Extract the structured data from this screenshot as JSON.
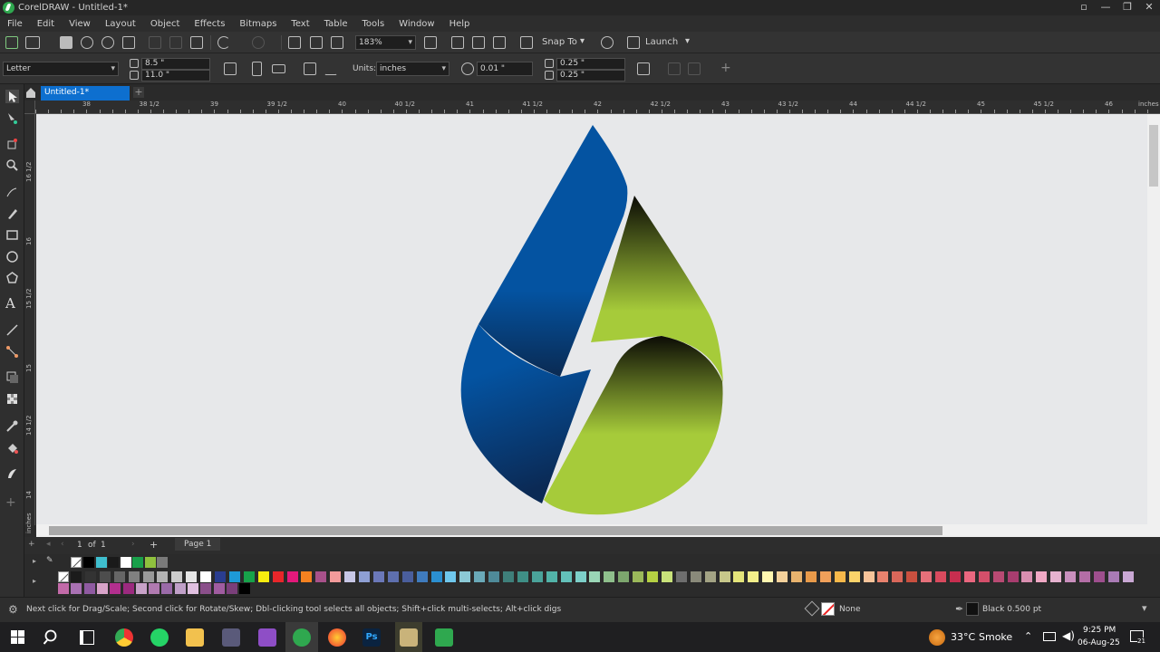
{
  "app": {
    "title": "CorelDRAW - Untitled-1*"
  },
  "menu": [
    "File",
    "Edit",
    "View",
    "Layout",
    "Object",
    "Effects",
    "Bitmaps",
    "Text",
    "Table",
    "Tools",
    "Window",
    "Help"
  ],
  "toolbar": {
    "zoom": "183%",
    "snap_to": "Snap To",
    "launch": "Launch"
  },
  "property_bar": {
    "page_size": "Letter",
    "width": "8.5 \"",
    "height": "11.0 \"",
    "units_label": "Units:",
    "units": "inches",
    "nudge": "0.01 \"",
    "dup_x": "0.25 \"",
    "dup_y": "0.25 \""
  },
  "document_tab": "Untitled-1*",
  "ruler": {
    "h_labels": [
      "38",
      "38 1/2",
      "39",
      "39 1/2",
      "40",
      "40 1/2",
      "41",
      "41 1/2",
      "42",
      "42 1/2",
      "43",
      "43 1/2",
      "44",
      "44 1/2",
      "45",
      "45 1/2",
      "46"
    ],
    "unit": "inches",
    "v_labels": [
      "16 1/2",
      "16",
      "15 1/2",
      "15",
      "14 1/2",
      "14"
    ]
  },
  "page_nav": {
    "current": "1",
    "of_label": "of",
    "total": "1",
    "page_tab": "Page 1"
  },
  "palette": {
    "row1": [
      "#ffffff",
      "#000000",
      "#3fbfcf",
      "#1a1a1a",
      "#ffffff",
      "#19a04a",
      "#8fc13e",
      "#7a7a7a"
    ],
    "row2": [
      "#ffffff",
      "#1b1b1b",
      "#333333",
      "#4d4d4d",
      "#666666",
      "#808080",
      "#999999",
      "#b3b3b3",
      "#cccccc",
      "#e6e6e6",
      "#ffffff",
      "#2a3d8f",
      "#1e9ad6",
      "#17a24a",
      "#f7ec0f",
      "#e8262a",
      "#e3197b",
      "#f48120",
      "#a8518a",
      "#f39b9b",
      "#c7c7e6",
      "#8e9fd3",
      "#6b78b8",
      "#5e6fae",
      "#4a5e9c",
      "#3f7bbd",
      "#2b8fd0",
      "#6fc7ec",
      "#8cc9d6",
      "#6aa9b8",
      "#4f8a99",
      "#3f7f7a",
      "#3f8f86",
      "#4aa39a",
      "#52b3a8",
      "#63c0b9",
      "#7dcfc8",
      "#9ad6b6",
      "#8fbf8c",
      "#7da66e",
      "#9bb85a",
      "#b5d043",
      "#c9e27a",
      "#6e6e6e",
      "#8a8a7a",
      "#a3a384",
      "#c7c78a",
      "#e4e47a",
      "#f2ee8a",
      "#fff7b0",
      "#f4d19b",
      "#e8b36e",
      "#e89a4a",
      "#f0a05a",
      "#f7b84a",
      "#fbd36a",
      "#f8c49a",
      "#e8826e",
      "#d9675a",
      "#c9503f",
      "#e5707a",
      "#d94a5e",
      "#c72e4f",
      "#e9677f",
      "#d44f6a",
      "#b84a73",
      "#a83d6f",
      "#d98fb0",
      "#f0a8c4",
      "#e6b2cf",
      "#c98fbd",
      "#b36ea6",
      "#9e4f8e",
      "#a97bb5",
      "#c9a8d4"
    ],
    "row3": [
      "#c26aa8",
      "#a971b3",
      "#8f5aa1",
      "#d8a3c9",
      "#b22f8e",
      "#9c2a7f",
      "#c8a2c8",
      "#b07ab0",
      "#9a6aa8",
      "#c0a0c8",
      "#e0c0e0",
      "#8a4f8a",
      "#a05ca0",
      "#7a3f7a",
      "#000000"
    ]
  },
  "status": {
    "hint": "Next click for Drag/Scale; Second click for Rotate/Skew; Dbl-clicking tool selects all objects; Shift+click multi-selects; Alt+click digs",
    "fill": "None",
    "outline": "Black  0.500 pt"
  },
  "taskbar": {
    "weather_temp": "33°C",
    "weather_text": "Smoke",
    "time": "9:25 PM",
    "date": "06-Aug-25",
    "notifications": "21"
  },
  "colors": {
    "logo_blue": "#0453a1",
    "logo_blue_dark": "#0a2a52",
    "logo_green": "#a6cb3a",
    "logo_green_dark": "#0b0b05",
    "tab_blue": "#0d6fcf"
  }
}
